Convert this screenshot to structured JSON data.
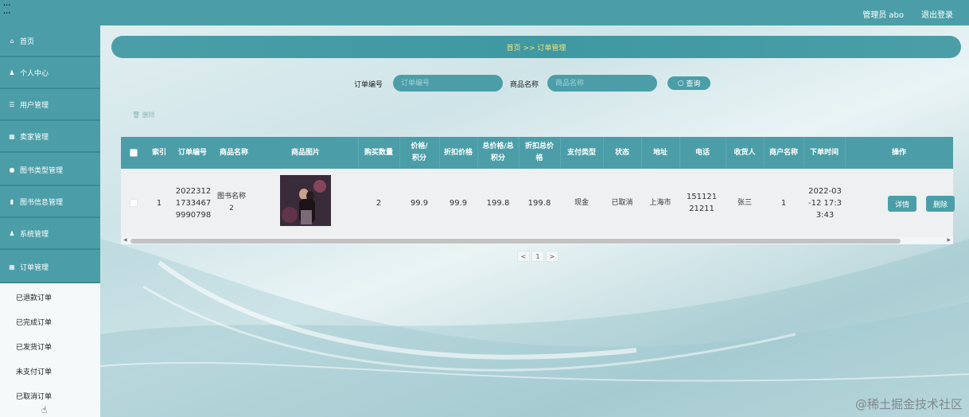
{
  "top": {
    "meta_line1": "...",
    "meta_line2": "...",
    "user": "管理员 abo",
    "logout": "退出登录"
  },
  "sidebar": {
    "items": [
      {
        "label": "首页",
        "icon": "home-icon",
        "glyph": "⌂"
      },
      {
        "label": "个人中心",
        "icon": "user-icon",
        "glyph": "♟"
      },
      {
        "label": "用户管理",
        "icon": "list-icon",
        "glyph": "☰"
      },
      {
        "label": "卖家管理",
        "icon": "grid-icon",
        "glyph": "▦"
      },
      {
        "label": "图书类型管理",
        "icon": "pin-icon",
        "glyph": "●"
      },
      {
        "label": "图书信息管理",
        "icon": "bar-chart-icon",
        "glyph": "▮"
      },
      {
        "label": "系统管理",
        "icon": "user-icon",
        "glyph": "♟"
      },
      {
        "label": "订单管理",
        "icon": "grid-icon",
        "glyph": "▦"
      }
    ],
    "submenu": [
      "已退款订单",
      "已完成订单",
      "已发货订单",
      "未支付订单",
      "已取消订单"
    ]
  },
  "breadcrumb": "首页 >> 订单管理",
  "search": {
    "order_label": "订单编号",
    "order_placeholder": "订单编号",
    "product_label": "商品名称",
    "product_placeholder": "商品名称",
    "button": "查询",
    "button_icon": "search-icon"
  },
  "batch_delete": "删除",
  "table": {
    "headers": [
      "索引",
      "订单编号",
      "商品名称",
      "商品图片",
      "购买数量",
      "价格/积分",
      "折扣价格",
      "总价格/总积分",
      "折扣总价格",
      "支付类型",
      "状态",
      "地址",
      "电话",
      "收货人",
      "商户名称",
      "下单时间",
      "操作"
    ],
    "rows": [
      {
        "index": "1",
        "order_no": "20223121733467 9990798",
        "product": "图书名称2",
        "qty": "2",
        "price": "99.9",
        "discount_price": "99.9",
        "total": "199.8",
        "discount_total": "199.8",
        "pay_type": "现金",
        "status": "已取消",
        "address": "上海市",
        "phone": "15112121211",
        "receiver": "张三",
        "merchant": "1",
        "time": "2022-03-12 17:33:43"
      }
    ],
    "detail_btn": "详情",
    "delete_btn": "删除"
  },
  "pager": {
    "prev": "<",
    "page": "1",
    "next": ">"
  },
  "watermark": "@稀土掘金技术社区"
}
